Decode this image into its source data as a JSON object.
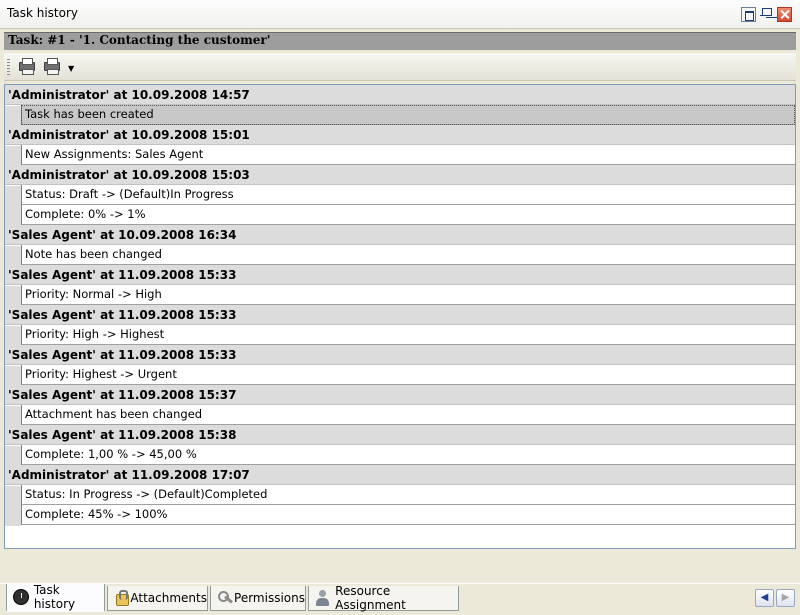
{
  "window": {
    "title": "Task history"
  },
  "task_header": "Task: #1 - '1. Contacting the customer'",
  "toolbar": {
    "print_icon": "printer-icon",
    "preview_icon": "print-preview-icon",
    "dropdown_glyph": "▼"
  },
  "history": [
    {
      "header": "'Administrator' at 10.09.2008 14:57",
      "rows": [
        "Task has been created"
      ],
      "selected_row": 0
    },
    {
      "header": "'Administrator' at 10.09.2008 15:01",
      "rows": [
        "New Assignments: Sales Agent"
      ]
    },
    {
      "header": "'Administrator' at 10.09.2008 15:03",
      "rows": [
        "Status: Draft -> (Default)In Progress",
        "Complete: 0% -> 1%"
      ]
    },
    {
      "header": "'Sales Agent' at 10.09.2008 16:34",
      "rows": [
        "Note has been changed"
      ]
    },
    {
      "header": "'Sales Agent' at 11.09.2008 15:33",
      "rows": [
        "Priority: Normal -> High"
      ]
    },
    {
      "header": "'Sales Agent' at 11.09.2008 15:33",
      "rows": [
        "Priority: High -> Highest"
      ]
    },
    {
      "header": "'Sales Agent' at 11.09.2008 15:33",
      "rows": [
        "Priority: Highest -> Urgent"
      ]
    },
    {
      "header": "'Sales Agent' at 11.09.2008 15:37",
      "rows": [
        "Attachment has been changed"
      ]
    },
    {
      "header": "'Sales Agent' at 11.09.2008 15:38",
      "rows": [
        "Complete: 1,00 % -> 45,00 %"
      ]
    },
    {
      "header": "'Administrator' at 11.09.2008 17:07",
      "rows": [
        "Status: In Progress -> (Default)Completed",
        "Complete: 45% -> 100%"
      ]
    }
  ],
  "tabs": [
    {
      "label": "Task history",
      "icon": "clock-icon",
      "active": true
    },
    {
      "label": "Attachments",
      "icon": "paperclip-icon"
    },
    {
      "label": "Permissions",
      "icon": "key-icon"
    },
    {
      "label": "Resource Assignment",
      "icon": "user-icon"
    }
  ],
  "tab_scroll": {
    "left": "◀",
    "right": "▶"
  }
}
